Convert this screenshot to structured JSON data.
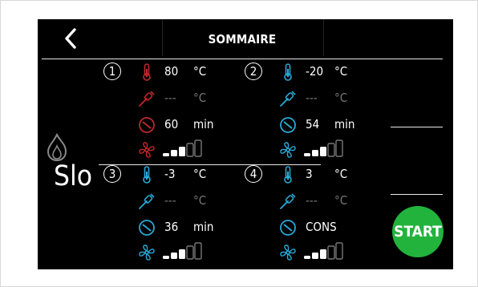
{
  "header": {
    "title": "SOMMAIRE"
  },
  "mode": {
    "label": "Slo"
  },
  "start_label": "START",
  "zones": [
    {
      "number": "1",
      "temp_value": "80",
      "temp_unit": "°C",
      "probe_value": "---",
      "probe_unit": "°C",
      "time_value": "60",
      "time_unit": "min",
      "fan_level": 3,
      "fan_levels": 5,
      "active": true
    },
    {
      "number": "2",
      "temp_value": "-20",
      "temp_unit": "°C",
      "probe_value": "---",
      "probe_unit": "°C",
      "time_value": "54",
      "time_unit": "min",
      "fan_level": 3,
      "fan_levels": 5,
      "active": false
    },
    {
      "number": "3",
      "temp_value": "-3",
      "temp_unit": "°C",
      "probe_value": "---",
      "probe_unit": "°C",
      "time_value": "36",
      "time_unit": "min",
      "fan_level": 3,
      "fan_levels": 5,
      "active": false
    },
    {
      "number": "4",
      "temp_value": "3",
      "temp_unit": "°C",
      "probe_value": "---",
      "probe_unit": "°C",
      "time_value": "CONS",
      "time_unit": "",
      "fan_level": 3,
      "fan_levels": 5,
      "active": false
    }
  ],
  "colors": {
    "active_icon": "#c0282a",
    "inactive_icon": "#29a8d6",
    "start": "#22b33c",
    "muted_text": "#777777"
  },
  "icons": {
    "back": "chevron-left-icon",
    "temp": "thermometer-icon",
    "probe": "probe-icon",
    "time": "timer-icon",
    "fan": "fan-icon",
    "flame": "flame-icon"
  }
}
